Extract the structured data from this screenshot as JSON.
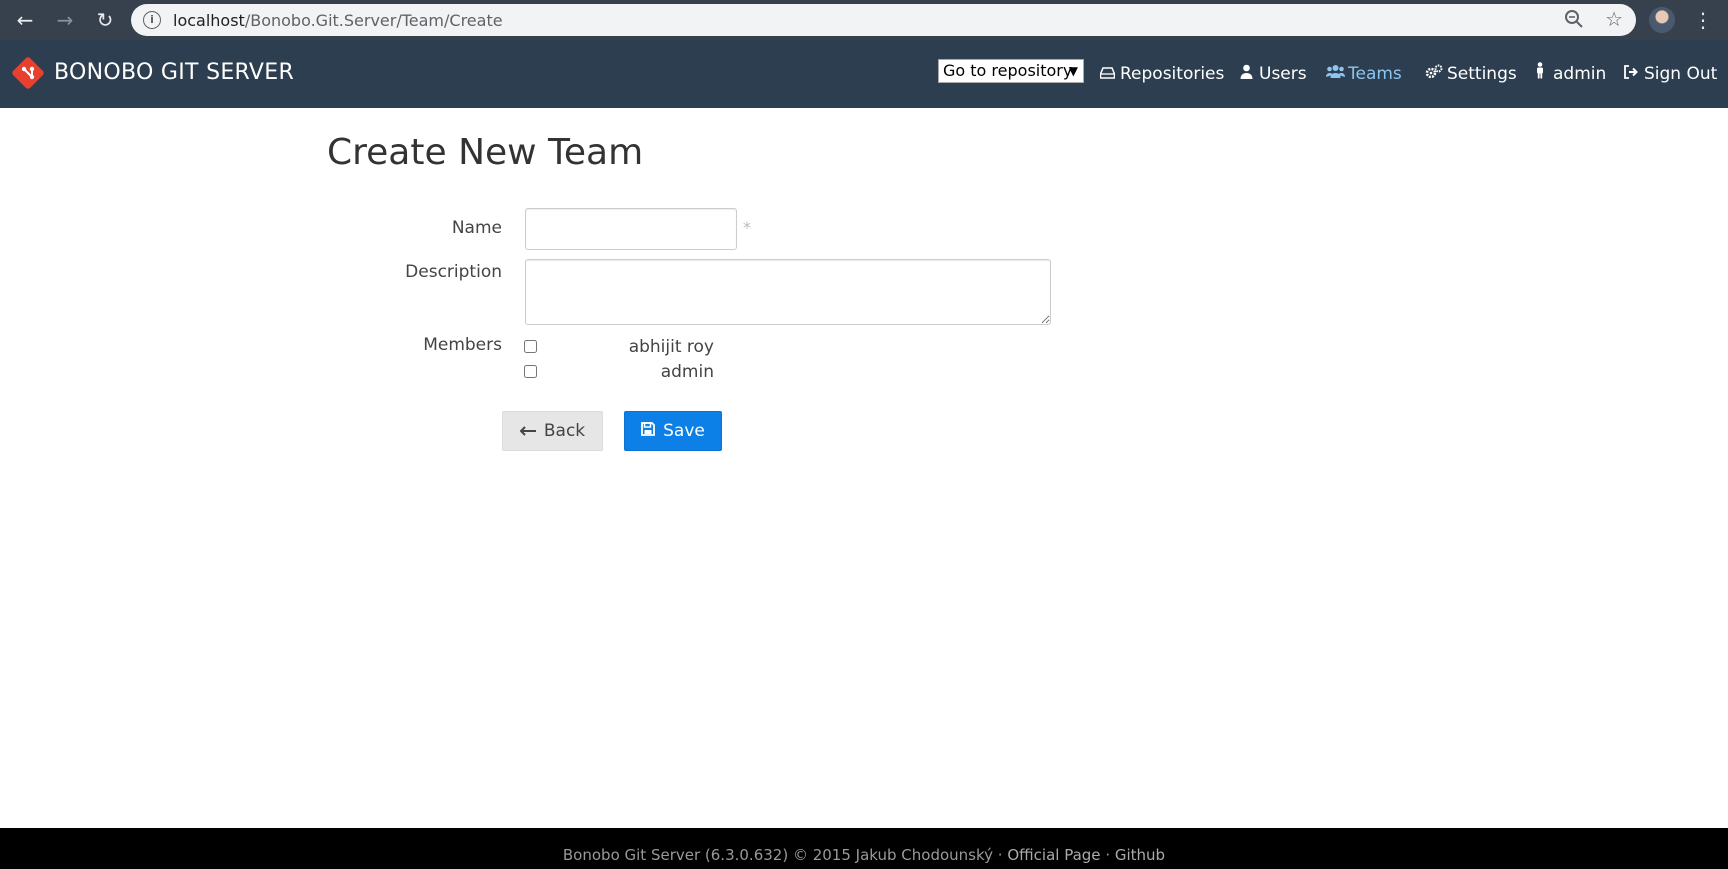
{
  "browser": {
    "url_host": "localhost",
    "url_path": "/Bonobo.Git.Server/Team/Create"
  },
  "navbar": {
    "brand": "BONOBO GIT SERVER",
    "repo_select": "Go to repository",
    "items": [
      {
        "label": "Repositories",
        "icon": "drive-icon",
        "active": false
      },
      {
        "label": "Users",
        "icon": "user-icon",
        "active": false
      },
      {
        "label": "Teams",
        "icon": "users-icon",
        "active": true
      },
      {
        "label": "Settings",
        "icon": "gears-icon",
        "active": false
      },
      {
        "label": "admin",
        "icon": "person-icon",
        "active": false
      },
      {
        "label": "Sign Out",
        "icon": "sign-out-icon",
        "active": false
      }
    ],
    "active_color": "#8ec5ef",
    "background": "#2c3e50"
  },
  "form": {
    "title": "Create New Team",
    "name_label": "Name",
    "name_value": "",
    "required_marker": "*",
    "description_label": "Description",
    "description_value": "",
    "members_label": "Members",
    "members": [
      {
        "name": "abhijit roy",
        "checked": false
      },
      {
        "name": "admin",
        "checked": false
      }
    ],
    "back_label": "Back",
    "save_label": "Save",
    "save_color": "#0c80e6"
  },
  "footer": {
    "text": "Bonobo Git Server (6.3.0.632) © 2015 Jakub Chodounský",
    "separator": "·",
    "official_page": "Official Page",
    "github": "Github"
  }
}
